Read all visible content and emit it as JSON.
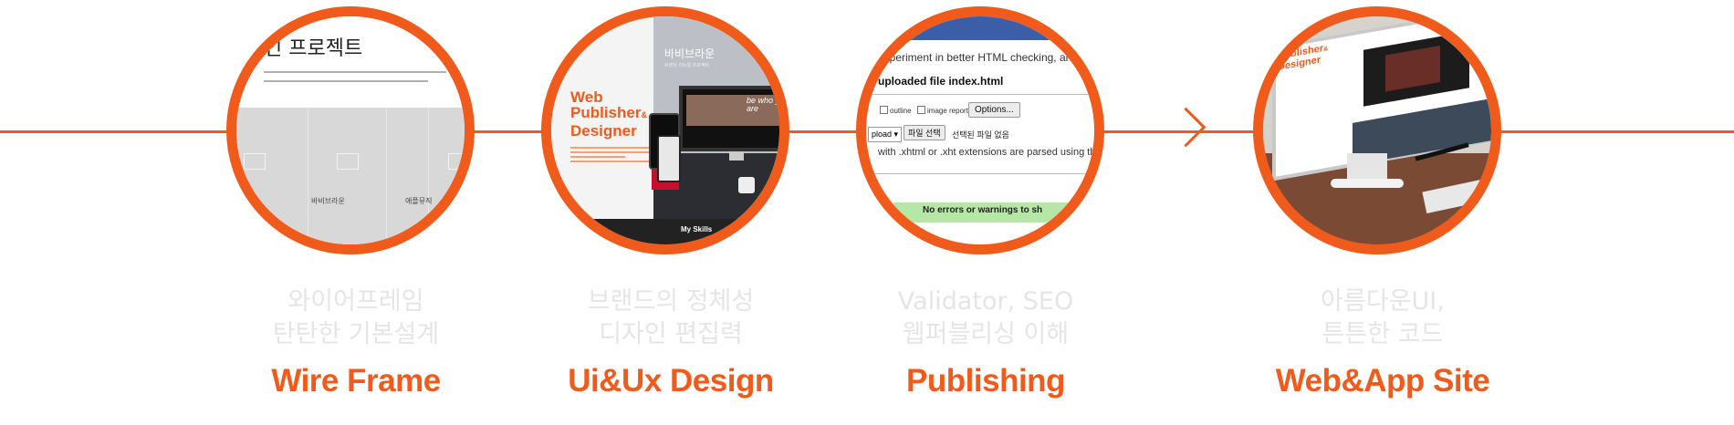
{
  "steps": [
    {
      "id": "wireframe",
      "caption_line1": "와이어프레임",
      "caption_line2": "탄탄한 기본설계",
      "title": "Wire Frame",
      "screenshot": {
        "heading": "인 프로젝트",
        "label_a": "바비브라운",
        "label_b": "애플뮤직"
      }
    },
    {
      "id": "uidesign",
      "caption_line1": "브랜드의 정체성",
      "caption_line2": "디자인 편집력",
      "title": "Ui&Ux Design",
      "screenshot": {
        "brand_line1": "Web",
        "brand_line2": "Publisher",
        "brand_amp": "&",
        "brand_line3": "Designer",
        "korean_title": "바비브라운",
        "korean_sub": "브랜딩 리뉴얼 프로젝트",
        "monitor_text": "be who you are",
        "footer_text": "My Skills"
      }
    },
    {
      "id": "publishing",
      "caption_line1": "Validator, SEO",
      "caption_line2": "웹퍼블리싱 이해",
      "title": "Publishing",
      "screenshot": {
        "line1": "experiment in better HTML checking, and",
        "line2": "uploaded file index.html",
        "check1": "outline",
        "check2": "image report",
        "options_button": "Options...",
        "select_value": "pload",
        "file_button": "파일 선택",
        "file_none": "선택된 파일 없음",
        "line3": "with .xhtml or .xht extensions are parsed using the",
        "result": "No errors or warnings to sh"
      }
    },
    {
      "id": "website",
      "caption_line1": "아름다운UI,",
      "caption_line2": "튼튼한 코드",
      "title": "Web&App Site",
      "screenshot": {
        "brand_line1": "Publisher",
        "brand_amp": "&",
        "brand_line2": "Designer"
      }
    }
  ],
  "colors": {
    "accent": "#f05a1a",
    "caption": "#e5e5e5"
  },
  "icons": {
    "timeline_arrow": "chevron-right-icon",
    "image_placeholder": "image-icon"
  }
}
